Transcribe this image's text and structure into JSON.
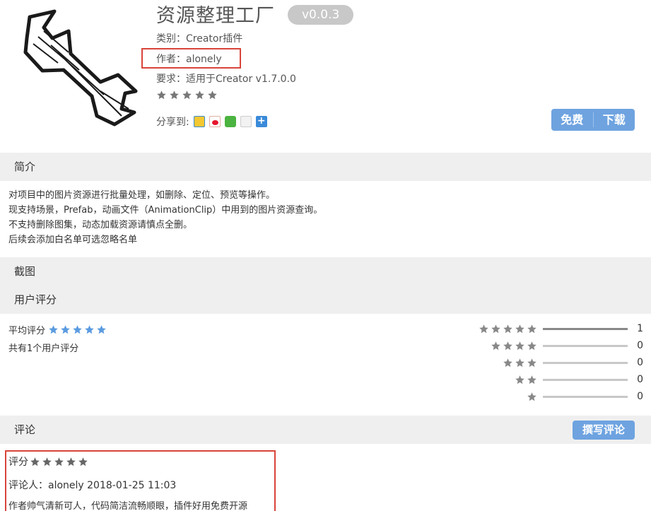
{
  "plugin": {
    "title": "资源整理工厂",
    "version": "v0.0.3",
    "category": "类别：Creator插件",
    "author": "作者：alonely",
    "requirement": "要求：适用于Creator v1.7.0.0",
    "star_rating": 5,
    "share_label": "分享到:",
    "share_icons": [
      "qzone-icon",
      "weibo-icon",
      "wechat-icon",
      "copy-icon",
      "more-icon"
    ]
  },
  "download": {
    "free_label": "免费",
    "download_label": "下载"
  },
  "sections": {
    "intro": "简介",
    "screenshots": "截图",
    "user_rating": "用户评分",
    "comments": "评论"
  },
  "intro_lines": [
    "对项目中的图片资源进行批量处理，如删除、定位、预览等操作。",
    "现支持场景，Prefab，动画文件（AnimationClip）中用到的图片资源查询。",
    "不支持删除图集，动态加载资源请慎点全删。",
    "后续会添加白名单可选忽略名单"
  ],
  "ratings": {
    "average_label": "平均评分",
    "average_stars": 5,
    "count_text": "共有1个用户评分",
    "distribution": [
      {
        "stars": 5,
        "count": "1",
        "fraction": 1.0
      },
      {
        "stars": 4,
        "count": "0",
        "fraction": 0
      },
      {
        "stars": 3,
        "count": "0",
        "fraction": 0
      },
      {
        "stars": 2,
        "count": "0",
        "fraction": 0
      },
      {
        "stars": 1,
        "count": "0",
        "fraction": 0
      }
    ]
  },
  "comments": {
    "write_button": "撰写评论",
    "review": {
      "score_label": "评分",
      "stars": 5,
      "author_line": "评论人：alonely  2018-01-25 11:03",
      "body": "作者帅气清新可人，代码简洁流畅顺眼，插件好用免费开源"
    }
  },
  "colors": {
    "accent_blue": "#6ea3e0",
    "highlight_red": "#d9443a",
    "section_gray": "#efefef",
    "star_gray": "#888888",
    "star_blue": "#5b9be0"
  }
}
